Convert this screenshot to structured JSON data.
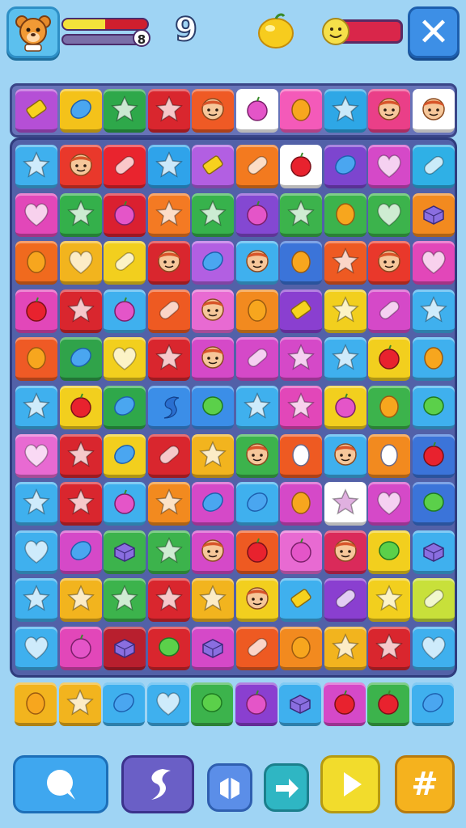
{
  "hud": {
    "hp_fraction": 0.5,
    "xp_count": "8",
    "moves": "9"
  },
  "icons": {
    "avatar": "bear-face-icon",
    "lemon": "lemon-icon",
    "coin": "smiley-coin-icon",
    "close": "close-icon"
  },
  "controls": [
    {
      "name": "chat-button",
      "icon": "chat-bubble-icon",
      "color": "#3fa7ef"
    },
    {
      "name": "boost-button",
      "icon": "swirl-icon",
      "color": "#6a5fc6"
    },
    {
      "name": "shuffle-button",
      "icon": "hexagon-icon",
      "color": "#5b8ee8"
    },
    {
      "name": "next-button",
      "icon": "arrow-right-icon",
      "color": "#2fb6c3"
    },
    {
      "name": "play-button",
      "icon": "play-icon",
      "color": "#f2dc2c"
    },
    {
      "name": "grid-button",
      "icon": "hash-icon",
      "color": "#f5b21e"
    }
  ],
  "top_row": [
    {
      "color": "#b54fd6",
      "icon": "candy-bar"
    },
    {
      "color": "#f4c21a",
      "icon": "blue-bean"
    },
    {
      "color": "#2ea84a",
      "icon": "star"
    },
    {
      "color": "#d9262e",
      "icon": "star"
    },
    {
      "color": "#ef5a25",
      "icon": "face"
    },
    {
      "color": "#ffffff",
      "icon": "pink-apple"
    },
    {
      "color": "#f45ab9",
      "icon": "orange-fruit"
    },
    {
      "color": "#2ea7e6",
      "icon": "star"
    },
    {
      "color": "#ea3f88",
      "icon": "face"
    },
    {
      "color": "#ffffff",
      "icon": "face"
    }
  ],
  "board": [
    [
      {
        "color": "#3fb0ee",
        "icon": "star"
      },
      {
        "color": "#e9382b",
        "icon": "face"
      },
      {
        "color": "#e9242e",
        "icon": "capsule"
      },
      {
        "color": "#2fa3ea",
        "icon": "star"
      },
      {
        "color": "#b25fe2",
        "icon": "candy-bar"
      },
      {
        "color": "#f37a1f",
        "icon": "capsule"
      },
      {
        "color": "#ffffff",
        "icon": "red-apple"
      },
      {
        "color": "#7d45cf",
        "icon": "blue-bean"
      },
      {
        "color": "#d549c8",
        "icon": "heart"
      },
      {
        "color": "#2fb0e6",
        "icon": "capsule"
      }
    ],
    [
      {
        "color": "#e247b9",
        "icon": "heart"
      },
      {
        "color": "#34b04b",
        "icon": "star"
      },
      {
        "color": "#da2030",
        "icon": "pink-apple"
      },
      {
        "color": "#f47a23",
        "icon": "star"
      },
      {
        "color": "#37b24c",
        "icon": "star"
      },
      {
        "color": "#8448d2",
        "icon": "pink-apple"
      },
      {
        "color": "#3cb34c",
        "icon": "star"
      },
      {
        "color": "#3cb34c",
        "icon": "orange-fruit"
      },
      {
        "color": "#3cb34c",
        "icon": "heart"
      },
      {
        "color": "#f28a1f",
        "icon": "box"
      }
    ],
    [
      {
        "color": "#f06a1e",
        "icon": "orange-fruit"
      },
      {
        "color": "#f2b41e",
        "icon": "heart"
      },
      {
        "color": "#f2cf1e",
        "icon": "capsule"
      },
      {
        "color": "#d9262e",
        "icon": "face"
      },
      {
        "color": "#b25fe2",
        "icon": "blue-bean"
      },
      {
        "color": "#3fb0ee",
        "icon": "face"
      },
      {
        "color": "#3b74d9",
        "icon": "orange-fruit"
      },
      {
        "color": "#ee5a22",
        "icon": "star"
      },
      {
        "color": "#e9382b",
        "icon": "face"
      },
      {
        "color": "#e247b9",
        "icon": "heart"
      }
    ],
    [
      {
        "color": "#e247b9",
        "icon": "red-apple"
      },
      {
        "color": "#d9262e",
        "icon": "star"
      },
      {
        "color": "#3fb0ee",
        "icon": "pink-apple"
      },
      {
        "color": "#ee5a22",
        "icon": "capsule"
      },
      {
        "color": "#e86ad2",
        "icon": "face"
      },
      {
        "color": "#f28a1f",
        "icon": "orange-fruit"
      },
      {
        "color": "#8a3fd0",
        "icon": "candy-bar"
      },
      {
        "color": "#f2cf1e",
        "icon": "star"
      },
      {
        "color": "#d549c8",
        "icon": "capsule"
      },
      {
        "color": "#3fb0ee",
        "icon": "star"
      }
    ],
    [
      {
        "color": "#ef5a25",
        "icon": "orange-fruit"
      },
      {
        "color": "#30a34a",
        "icon": "blue-bean"
      },
      {
        "color": "#f2cf1e",
        "icon": "heart"
      },
      {
        "color": "#d9262e",
        "icon": "star"
      },
      {
        "color": "#d549c8",
        "icon": "face"
      },
      {
        "color": "#d549c8",
        "icon": "capsule"
      },
      {
        "color": "#d549c8",
        "icon": "star"
      },
      {
        "color": "#3fb0ee",
        "icon": "star"
      },
      {
        "color": "#f2cf1e",
        "icon": "red-apple"
      },
      {
        "color": "#3fb0ee",
        "icon": "orange-fruit"
      }
    ],
    [
      {
        "color": "#3fb0ee",
        "icon": "star"
      },
      {
        "color": "#f2cf1e",
        "icon": "red-apple"
      },
      {
        "color": "#2fa84a",
        "icon": "blue-bean"
      },
      {
        "color": "#3b8ee8",
        "icon": "swirl"
      },
      {
        "color": "#3b8ee8",
        "icon": "green-bean"
      },
      {
        "color": "#3fb0ee",
        "icon": "star"
      },
      {
        "color": "#e247b9",
        "icon": "star"
      },
      {
        "color": "#f2cf1e",
        "icon": "pink-apple"
      },
      {
        "color": "#3cb34c",
        "icon": "orange-fruit"
      },
      {
        "color": "#3fb0ee",
        "icon": "green-bean"
      }
    ],
    [
      {
        "color": "#e86ad2",
        "icon": "heart"
      },
      {
        "color": "#d9262e",
        "icon": "star"
      },
      {
        "color": "#f2cf1e",
        "icon": "blue-bean"
      },
      {
        "color": "#d9262e",
        "icon": "capsule"
      },
      {
        "color": "#f2b41e",
        "icon": "star"
      },
      {
        "color": "#3cb34c",
        "icon": "face"
      },
      {
        "color": "#ee5a22",
        "icon": "white-egg"
      },
      {
        "color": "#3fb0ee",
        "icon": "face"
      },
      {
        "color": "#f28a1f",
        "icon": "white-egg"
      },
      {
        "color": "#3b74d9",
        "icon": "red-apple"
      }
    ],
    [
      {
        "color": "#3fb0ee",
        "icon": "star"
      },
      {
        "color": "#d9262e",
        "icon": "star"
      },
      {
        "color": "#3fb0ee",
        "icon": "pink-apple"
      },
      {
        "color": "#f28a1f",
        "icon": "star"
      },
      {
        "color": "#d549c8",
        "icon": "blue-bean"
      },
      {
        "color": "#3fb0ee",
        "icon": "blue-bean"
      },
      {
        "color": "#d549c8",
        "icon": "orange-fruit"
      },
      {
        "color": "#ffffff",
        "icon": "star"
      },
      {
        "color": "#d549c8",
        "icon": "heart"
      },
      {
        "color": "#3b74d9",
        "icon": "green-bean"
      }
    ],
    [
      {
        "color": "#3fb0ee",
        "icon": "heart"
      },
      {
        "color": "#d549c8",
        "icon": "blue-bean"
      },
      {
        "color": "#3cb34c",
        "icon": "box"
      },
      {
        "color": "#3cb34c",
        "icon": "star"
      },
      {
        "color": "#d549c8",
        "icon": "face"
      },
      {
        "color": "#ee5a22",
        "icon": "red-apple"
      },
      {
        "color": "#e86ad2",
        "icon": "pink-apple"
      },
      {
        "color": "#da2a5a",
        "icon": "face"
      },
      {
        "color": "#f2cf1e",
        "icon": "green-bean"
      },
      {
        "color": "#3fb0ee",
        "icon": "box"
      }
    ],
    [
      {
        "color": "#3fb0ee",
        "icon": "star"
      },
      {
        "color": "#f2b41e",
        "icon": "star"
      },
      {
        "color": "#3cb34c",
        "icon": "star"
      },
      {
        "color": "#d9262e",
        "icon": "star"
      },
      {
        "color": "#f2b41e",
        "icon": "star"
      },
      {
        "color": "#f2cf1e",
        "icon": "face"
      },
      {
        "color": "#3fb0ee",
        "icon": "candy-bar"
      },
      {
        "color": "#8a3fd0",
        "icon": "capsule"
      },
      {
        "color": "#f2cf1e",
        "icon": "star"
      },
      {
        "color": "#c8e03a",
        "icon": "capsule"
      }
    ],
    [
      {
        "color": "#3fb0ee",
        "icon": "heart"
      },
      {
        "color": "#e247b9",
        "icon": "pink-apple"
      },
      {
        "color": "#b81f2e",
        "icon": "box"
      },
      {
        "color": "#d9262e",
        "icon": "green-bean"
      },
      {
        "color": "#d549c8",
        "icon": "box"
      },
      {
        "color": "#ee5a22",
        "icon": "capsule"
      },
      {
        "color": "#f28a1f",
        "icon": "orange-fruit"
      },
      {
        "color": "#f2b41e",
        "icon": "star"
      },
      {
        "color": "#d9262e",
        "icon": "star"
      },
      {
        "color": "#3fb0ee",
        "icon": "heart"
      }
    ]
  ],
  "bottom_row": [
    {
      "color": "#f2b41e",
      "icon": "orange-fruit"
    },
    {
      "color": "#f2b41e",
      "icon": "star"
    },
    {
      "color": "#3fb0ee",
      "icon": "blue-bean"
    },
    {
      "color": "#3fb0ee",
      "icon": "heart"
    },
    {
      "color": "#3cb34c",
      "icon": "green-bean"
    },
    {
      "color": "#8a3fd0",
      "icon": "pink-apple"
    },
    {
      "color": "#3fb0ee",
      "icon": "box"
    },
    {
      "color": "#d549c8",
      "icon": "red-apple"
    },
    {
      "color": "#3cb34c",
      "icon": "red-apple"
    },
    {
      "color": "#3fb0ee",
      "icon": "blue-bean"
    }
  ]
}
